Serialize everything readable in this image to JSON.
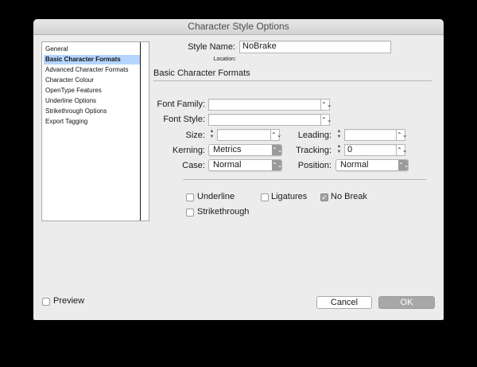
{
  "window": {
    "title": "Character Style Options"
  },
  "sidebar": {
    "items": [
      {
        "label": "General"
      },
      {
        "label": "Basic Character Formats"
      },
      {
        "label": "Advanced Character Formats"
      },
      {
        "label": "Character Colour"
      },
      {
        "label": "OpenType Features"
      },
      {
        "label": "Underline Options"
      },
      {
        "label": "Strikethrough Options"
      },
      {
        "label": "Export Tagging"
      }
    ],
    "selected": "Basic Character Formats"
  },
  "header": {
    "style_name_label": "Style Name:",
    "style_name_value": "NoBrake",
    "location_label": "Location:"
  },
  "section": {
    "title": "Basic Character Formats"
  },
  "form": {
    "font_family_label": "Font Family:",
    "font_family_value": "",
    "font_style_label": "Font Style:",
    "font_style_value": "",
    "size_label": "Size:",
    "size_value": "",
    "leading_label": "Leading:",
    "leading_value": "",
    "kerning_label": "Kerning:",
    "kerning_value": "Metrics",
    "tracking_label": "Tracking:",
    "tracking_value": "0",
    "case_label": "Case:",
    "case_value": "Normal",
    "position_label": "Position:",
    "position_value": "Normal"
  },
  "checkboxes": {
    "underline": {
      "label": "Underline",
      "checked": false
    },
    "ligatures": {
      "label": "Ligatures",
      "checked": false
    },
    "no_break": {
      "label": "No Break",
      "checked": true
    },
    "strikethrough": {
      "label": "Strikethrough",
      "checked": false
    }
  },
  "footer": {
    "preview_label": "Preview",
    "preview_checked": false,
    "cancel_label": "Cancel",
    "ok_label": "OK"
  },
  "icons": {
    "combo": "chevron-up-down-icon",
    "spin": "stepper-arrows-icon",
    "check": "checkmark-icon"
  }
}
